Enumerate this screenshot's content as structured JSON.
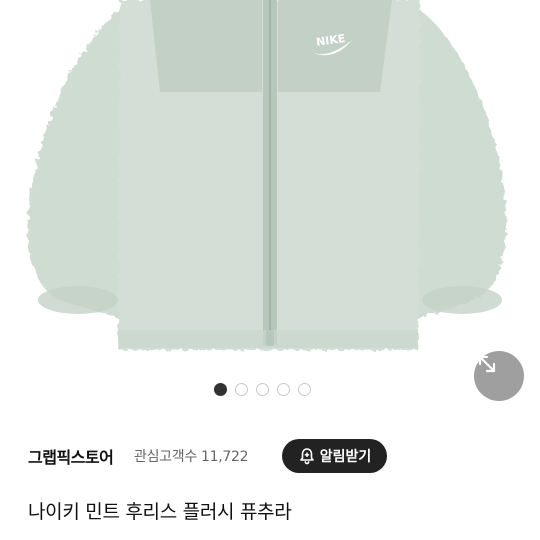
{
  "product": {
    "title": "나이키 민트 후리스 플러시 퓨추라",
    "brand_logo_text": "NIKE",
    "image_color": "#d3dfd6"
  },
  "gallery": {
    "total_images": 5,
    "active_index": 0,
    "expand_icon": "expand-arrows-icon"
  },
  "seller": {
    "store_name": "그랩픽스토어",
    "followers_label": "관심고객수 11,722",
    "notify_button_label": "알림받기",
    "notify_icon": "bell-plus-icon"
  }
}
